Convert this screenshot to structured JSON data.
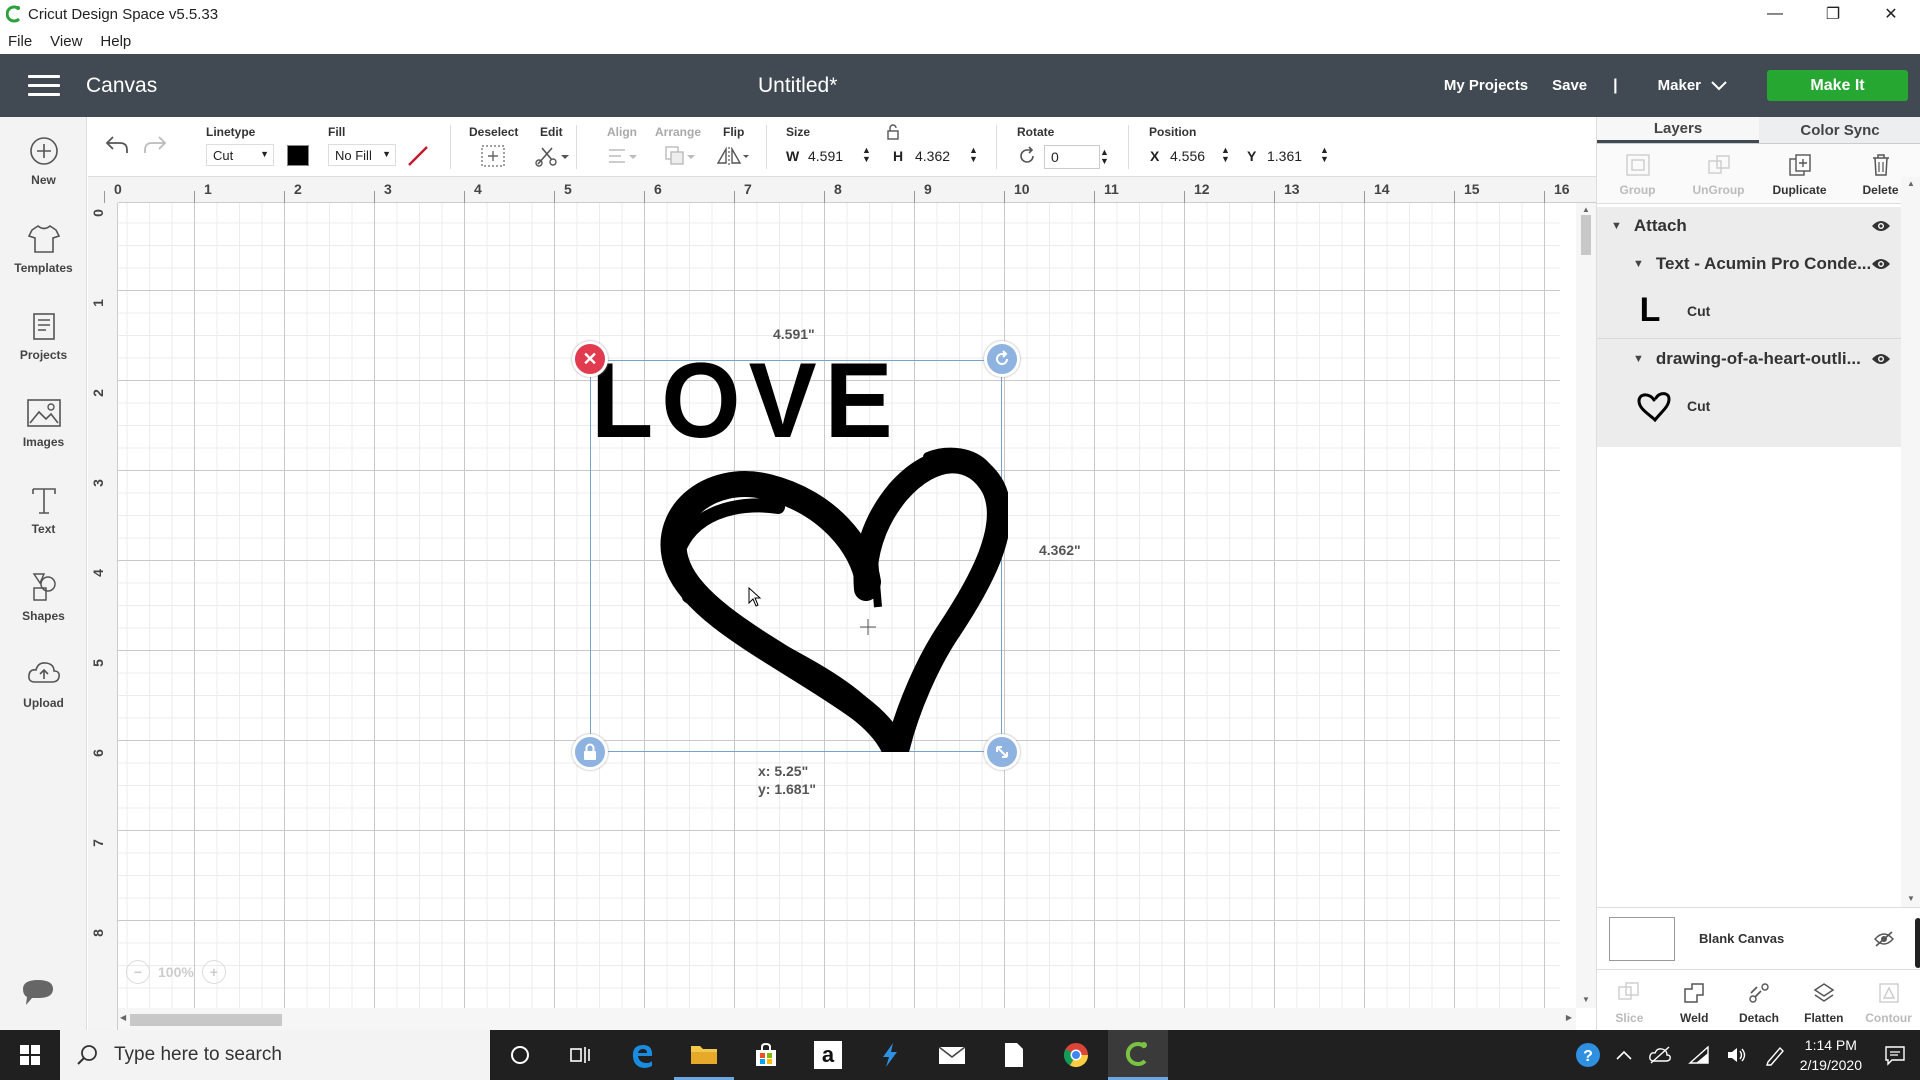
{
  "window": {
    "title": "Cricut Design Space  v5.5.33",
    "min": "—",
    "max": "❐",
    "close": "✕"
  },
  "menu": [
    "File",
    "View",
    "Help"
  ],
  "header": {
    "section": "Canvas",
    "doc_title": "Untitled*",
    "my_projects": "My Projects",
    "save": "Save",
    "separator": "|",
    "machine": "Maker",
    "make_it": "Make It"
  },
  "sidebar": [
    {
      "label": "New",
      "icon": "plus-circle-icon"
    },
    {
      "label": "Templates",
      "icon": "tshirt-icon"
    },
    {
      "label": "Projects",
      "icon": "projects-icon"
    },
    {
      "label": "Images",
      "icon": "image-icon"
    },
    {
      "label": "Text",
      "icon": "text-icon"
    },
    {
      "label": "Shapes",
      "icon": "shapes-icon"
    },
    {
      "label": "Upload",
      "icon": "upload-cloud-icon"
    }
  ],
  "toolbar": {
    "linetype_label": "Linetype",
    "linetype_value": "Cut",
    "fill_label": "Fill",
    "fill_value": "No Fill",
    "deselect_label": "Deselect",
    "edit_label": "Edit",
    "align_label": "Align",
    "arrange_label": "Arrange",
    "flip_label": "Flip",
    "size_label": "Size",
    "w_label": "W",
    "w_value": "4.591",
    "h_label": "H",
    "h_value": "4.362",
    "rotate_label": "Rotate",
    "rotate_value": "0",
    "position_label": "Position",
    "x_label": "X",
    "x_value": "4.556",
    "y_label": "Y",
    "y_value": "1.361"
  },
  "ruler": {
    "h": [
      "0",
      "1",
      "2",
      "3",
      "4",
      "5",
      "6",
      "7",
      "8",
      "9",
      "10",
      "11",
      "12",
      "13",
      "14",
      "15",
      "16"
    ],
    "v": [
      "0",
      "1",
      "2",
      "3",
      "4",
      "5",
      "6",
      "7",
      "8"
    ]
  },
  "selection": {
    "width_label": "4.591\"",
    "height_label": "4.362\"",
    "pos_x": "x: 5.25\"",
    "pos_y": "y: 1.681\"",
    "text": "LOVE"
  },
  "zoom": {
    "value": "100%",
    "minus": "−",
    "plus": "+"
  },
  "panel": {
    "tab_layers": "Layers",
    "tab_colorsync": "Color Sync",
    "tools": [
      {
        "label": "Group",
        "enabled": false
      },
      {
        "label": "UnGroup",
        "enabled": false
      },
      {
        "label": "Duplicate",
        "enabled": true
      },
      {
        "label": "Delete",
        "enabled": true
      }
    ],
    "group_name": "Attach",
    "layer1_name": "Text - Acumin Pro Conde...",
    "layer1_thumb": "L",
    "layer1_type": "Cut",
    "layer2_name": "drawing-of-a-heart-outli...",
    "layer2_type": "Cut",
    "blank_canvas": "Blank Canvas",
    "bottom_tools": [
      {
        "label": "Slice",
        "enabled": false
      },
      {
        "label": "Weld",
        "enabled": true
      },
      {
        "label": "Detach",
        "enabled": true
      },
      {
        "label": "Flatten",
        "enabled": true
      },
      {
        "label": "Contour",
        "enabled": false
      }
    ]
  },
  "taskbar": {
    "search_placeholder": "Type here to search",
    "time": "1:14 PM",
    "date": "2/19/2020"
  },
  "colors": {
    "header": "#414a52",
    "make_it": "#25a732",
    "delete_handle": "#e23b4f",
    "handle": "#8fb3e0"
  }
}
